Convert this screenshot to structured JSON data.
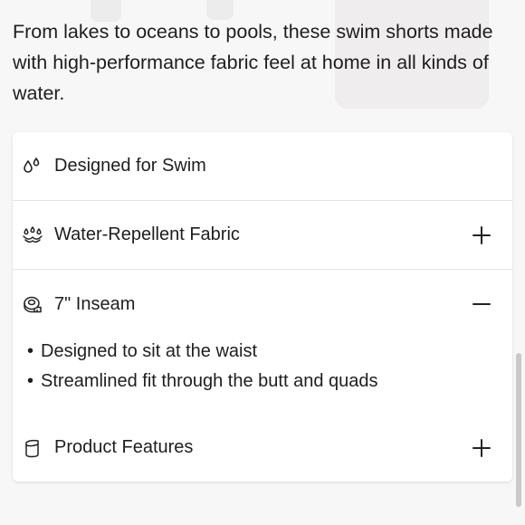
{
  "intro_text": "From lakes to oceans to pools, these swim shorts made with high-performance fabric feel at home in all kinds of water.",
  "accordion": [
    {
      "label": "Designed for Swim",
      "icon": "water-drops-icon",
      "state": "none"
    },
    {
      "label": "Water-Repellent Fabric",
      "icon": "water-repellent-icon",
      "state": "collapsed"
    },
    {
      "label": "7\" Inseam",
      "icon": "measuring-tape-icon",
      "state": "expanded",
      "bullets": [
        "Designed to sit at the waist",
        "Streamlined fit through the butt and quads"
      ]
    },
    {
      "label": "Product Features",
      "icon": "features-icon",
      "state": "collapsed"
    }
  ],
  "colors": {
    "background": "#f7f7f7",
    "card": "#ffffff",
    "divider": "#e4e4e4",
    "text": "#1e1e1e"
  }
}
